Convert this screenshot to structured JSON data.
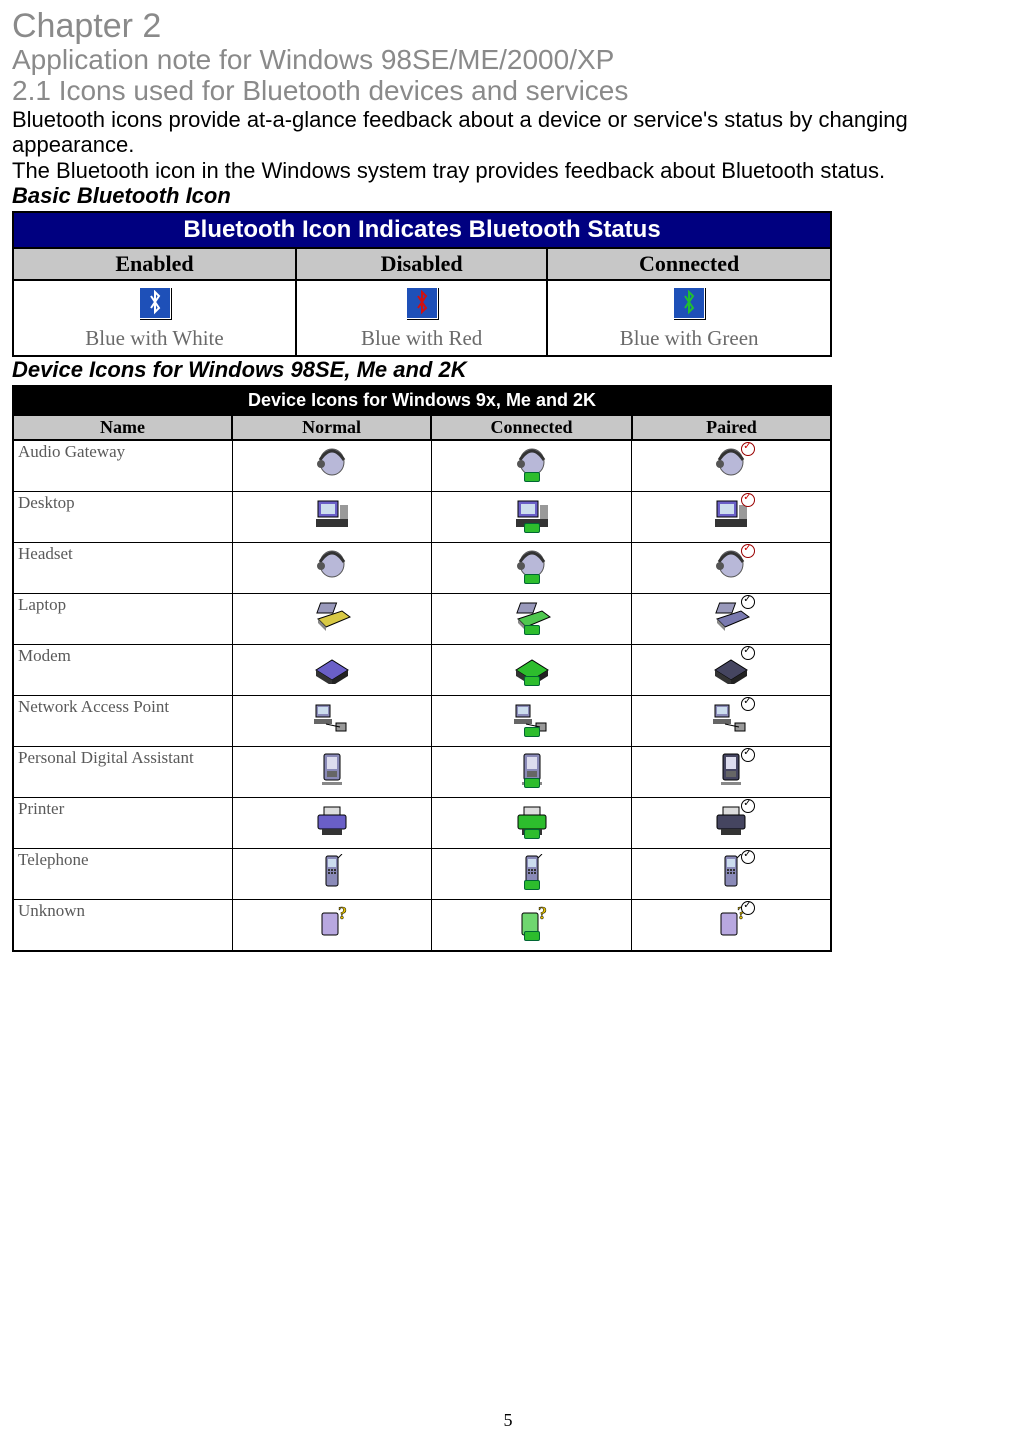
{
  "chapter_title": "Chapter 2",
  "subtitle": "Application note for Windows 98SE/ME/2000/XP",
  "section_title": "2.1 Icons used for Bluetooth devices and services",
  "para1": "Bluetooth icons provide at-a-glance feedback about a device or service's status by changing appearance.",
  "para2": "The Bluetooth icon in the Windows system tray provides feedback about Bluetooth status.",
  "basic_heading": "Basic Bluetooth Icon",
  "table1": {
    "title": "Bluetooth Icon Indicates Bluetooth Status",
    "cols": [
      "Enabled",
      "Disabled",
      "Connected"
    ],
    "captions": [
      "Blue with White",
      "Blue with Red",
      "Blue with Green"
    ],
    "icon_fg": [
      "#ffffff",
      "#d01010",
      "#20c030"
    ]
  },
  "device_heading": "Device Icons for Windows 98SE, Me and 2K",
  "table2": {
    "title": "Device Icons for Windows 9x, Me and 2K",
    "headers": [
      "Name",
      "Normal",
      "Connected",
      "Paired"
    ],
    "rows": [
      {
        "name": "Audio Gateway",
        "shape": "headset",
        "fill_normal": "#b8b8d8",
        "fill_conn": "#b8b8d8",
        "fill_pair": "#b8b8d8",
        "pair_badge": "redcheck"
      },
      {
        "name": "Desktop",
        "shape": "desktop",
        "fill_normal": "#6a5fc7",
        "fill_conn": "#6a5fc7",
        "fill_pair": "#6a5fc7",
        "pair_badge": "redcheck"
      },
      {
        "name": "Headset",
        "shape": "headset",
        "fill_normal": "#b8b8d8",
        "fill_conn": "#b8b8d8",
        "fill_pair": "#b8b8d8",
        "pair_badge": "redcheck"
      },
      {
        "name": "Laptop",
        "shape": "laptop",
        "fill_normal": "#d8c945",
        "fill_conn": "#4fc74f",
        "fill_pair": "#7a7ab0",
        "pair_badge": "check"
      },
      {
        "name": "Modem",
        "shape": "modem",
        "fill_normal": "#6a5fc7",
        "fill_conn": "#2dbd2d",
        "fill_pair": "#454560",
        "pair_badge": "check"
      },
      {
        "name": "Network Access Point",
        "shape": "network",
        "fill_normal": "#8a8ab8",
        "fill_conn": "#8a8ab8",
        "fill_pair": "#8a8ab8",
        "pair_badge": "check"
      },
      {
        "name": "Personal Digital Assistant",
        "shape": "pda",
        "fill_normal": "#8a8ab8",
        "fill_conn": "#8a8ab8",
        "fill_pair": "#454560",
        "pair_badge": "check"
      },
      {
        "name": "Printer",
        "shape": "printer",
        "fill_normal": "#6a5fc7",
        "fill_conn": "#2dbd2d",
        "fill_pair": "#454560",
        "pair_badge": "check"
      },
      {
        "name": "Telephone",
        "shape": "phone",
        "fill_normal": "#8a8ab8",
        "fill_conn": "#8a8ab8",
        "fill_pair": "#8a8ab8",
        "pair_badge": "check"
      },
      {
        "name": "Unknown",
        "shape": "unknown",
        "fill_normal": "#b8a8e0",
        "fill_conn": "#6fd66f",
        "fill_pair": "#b8a8e0",
        "pair_badge": "check"
      }
    ]
  },
  "page_number": "5"
}
